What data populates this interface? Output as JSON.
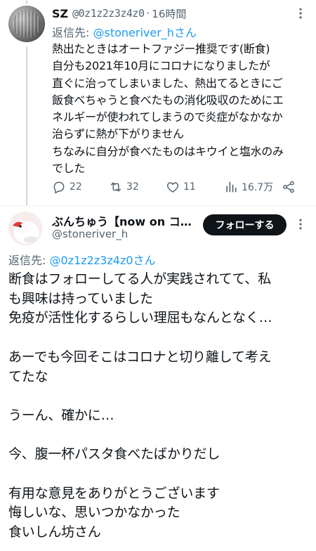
{
  "reply_tweet": {
    "author_name": "SZ",
    "author_handle": "@0z1z2z3z4z0",
    "separator": "·",
    "time": "16時間",
    "reply_prefix": "返信先: ",
    "reply_to": "@stoneriver_hさん",
    "body_lines": [
      "熱出たときはオートファジー推奨です(断食)",
      "自分も2021年10月にコロナになりましたが",
      "直ぐに治ってしまいました、熱出てるときにご",
      "飯食べちゃうと食べたもの消化吸収のためにエ",
      "ネルギーが使われてしまうので炎症がなかなか",
      "治らずに熱が下がりません",
      "ちなみに自分が食べたものはキウイと塩水のみ",
      "でした"
    ],
    "actions": {
      "replies": "22",
      "retweets": "32",
      "likes": "11",
      "views": "16.7万"
    },
    "icons": [
      "more-icon",
      "reply-icon",
      "retweet-icon",
      "like-icon",
      "views-icon",
      "share-icon"
    ]
  },
  "main_tweet": {
    "author_name": "ぶんちゅう【now on コ…",
    "author_handle": "@stoneriver_h",
    "follow_label": "フォローする",
    "reply_prefix": "返信先: ",
    "reply_to": "@0z1z2z3z4z0さん",
    "body_lines": [
      "断食はフォローしてる人が実践されてて、私",
      "も興味は持っていました",
      "免疫が活性化するらしい理屈もなんとなく…",
      "",
      "あーでも今回そこはコロナと切り離して考え",
      "てたな",
      "",
      "うーん、確かに…",
      "",
      "今、腹一杯パスタ食べたばかりだし",
      "",
      "有用な意見をありがとうございます",
      "悔しいな、思いつかなかった",
      "食いしん坊さん"
    ]
  },
  "colors": {
    "text": "#0f1419",
    "secondary": "#536471",
    "link": "#1d9bf0",
    "follow_button": "#0f1419"
  }
}
